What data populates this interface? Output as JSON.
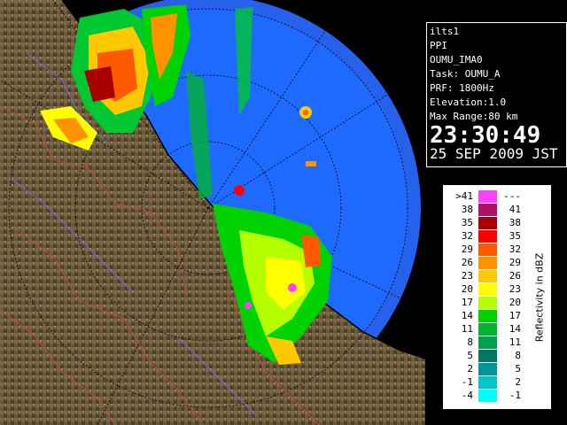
{
  "info": {
    "station": "ilts1",
    "scan_type": "PPI",
    "radar": "OUMU_IMA0",
    "task": "Task: OUMU_A",
    "prf": "PRF: 1800Hz",
    "elevation": "Elevation:1.0",
    "max_range": "Max Range:80 km",
    "time": "23:30:49",
    "date": "25 SEP 2009 JST"
  },
  "legend": {
    "title": "Reflectivity in dBZ",
    "rows": [
      {
        "low": ">41",
        "high": "---",
        "color": "#ff40ff"
      },
      {
        "low": "38",
        "high": "41",
        "color": "#b0106a"
      },
      {
        "low": "35",
        "high": "38",
        "color": "#a80000"
      },
      {
        "low": "32",
        "high": "35",
        "color": "#ff0000"
      },
      {
        "low": "29",
        "high": "32",
        "color": "#ff5a00"
      },
      {
        "low": "26",
        "high": "29",
        "color": "#ff9200"
      },
      {
        "low": "23",
        "high": "26",
        "color": "#ffc800"
      },
      {
        "low": "20",
        "high": "23",
        "color": "#ffff00"
      },
      {
        "low": "17",
        "high": "20",
        "color": "#b4ff00"
      },
      {
        "low": "14",
        "high": "17",
        "color": "#00d200"
      },
      {
        "low": "11",
        "high": "14",
        "color": "#00b432"
      },
      {
        "low": "8",
        "high": "11",
        "color": "#00a050"
      },
      {
        "low": "5",
        "high": "8",
        "color": "#007864"
      },
      {
        "low": "2",
        "high": "5",
        "color": "#009696"
      },
      {
        "low": "-1",
        "high": "2",
        "color": "#00c8c8"
      },
      {
        "low": "-4",
        "high": "-1",
        "color": "#00ffff"
      }
    ]
  },
  "colors": {
    "radar_coverage": "#1e6aff",
    "radar_edge": "#2255ee",
    "land": "#6b5a3a",
    "background": "#000000"
  }
}
